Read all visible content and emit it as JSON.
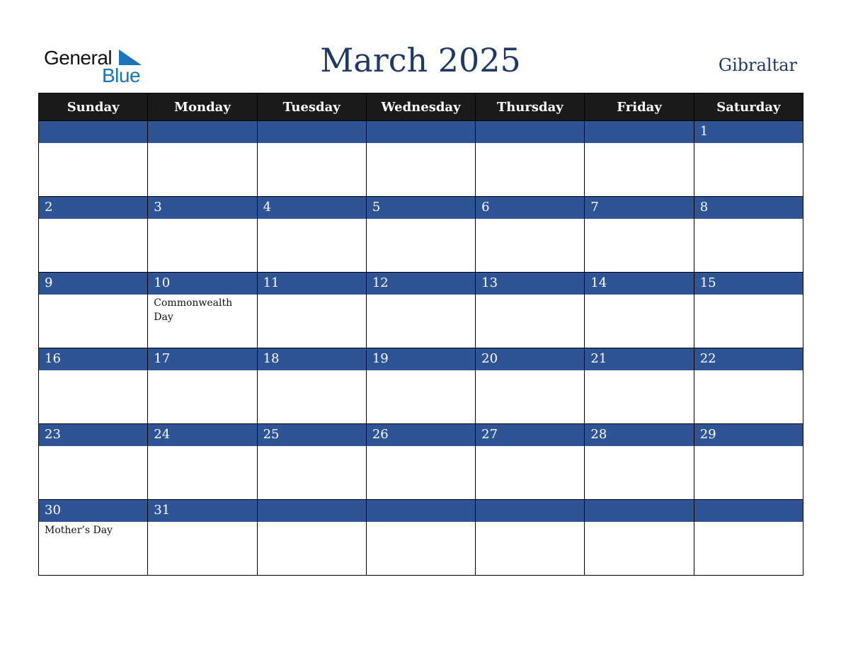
{
  "logo": {
    "general": "General",
    "blue": "Blue"
  },
  "header": {
    "title": "March 2025",
    "country": "Gibraltar"
  },
  "colors": {
    "header_bg": "#1a1a1a",
    "date_bar": "#2e5496",
    "title": "#1f3864",
    "logo_blue": "#1b75bc"
  },
  "weekdays": [
    "Sunday",
    "Monday",
    "Tuesday",
    "Wednesday",
    "Thursday",
    "Friday",
    "Saturday"
  ],
  "weeks": [
    [
      {
        "day": ""
      },
      {
        "day": ""
      },
      {
        "day": ""
      },
      {
        "day": ""
      },
      {
        "day": ""
      },
      {
        "day": ""
      },
      {
        "day": "1"
      }
    ],
    [
      {
        "day": "2"
      },
      {
        "day": "3"
      },
      {
        "day": "4"
      },
      {
        "day": "5"
      },
      {
        "day": "6"
      },
      {
        "day": "7"
      },
      {
        "day": "8"
      }
    ],
    [
      {
        "day": "9"
      },
      {
        "day": "10",
        "holiday": "Commonwealth Day"
      },
      {
        "day": "11"
      },
      {
        "day": "12"
      },
      {
        "day": "13"
      },
      {
        "day": "14"
      },
      {
        "day": "15"
      }
    ],
    [
      {
        "day": "16"
      },
      {
        "day": "17"
      },
      {
        "day": "18"
      },
      {
        "day": "19"
      },
      {
        "day": "20"
      },
      {
        "day": "21"
      },
      {
        "day": "22"
      }
    ],
    [
      {
        "day": "23"
      },
      {
        "day": "24"
      },
      {
        "day": "25"
      },
      {
        "day": "26"
      },
      {
        "day": "27"
      },
      {
        "day": "28"
      },
      {
        "day": "29"
      }
    ],
    [
      {
        "day": "30",
        "holiday": "Mother’s Day"
      },
      {
        "day": "31"
      },
      {
        "day": ""
      },
      {
        "day": ""
      },
      {
        "day": ""
      },
      {
        "day": ""
      },
      {
        "day": ""
      }
    ]
  ]
}
